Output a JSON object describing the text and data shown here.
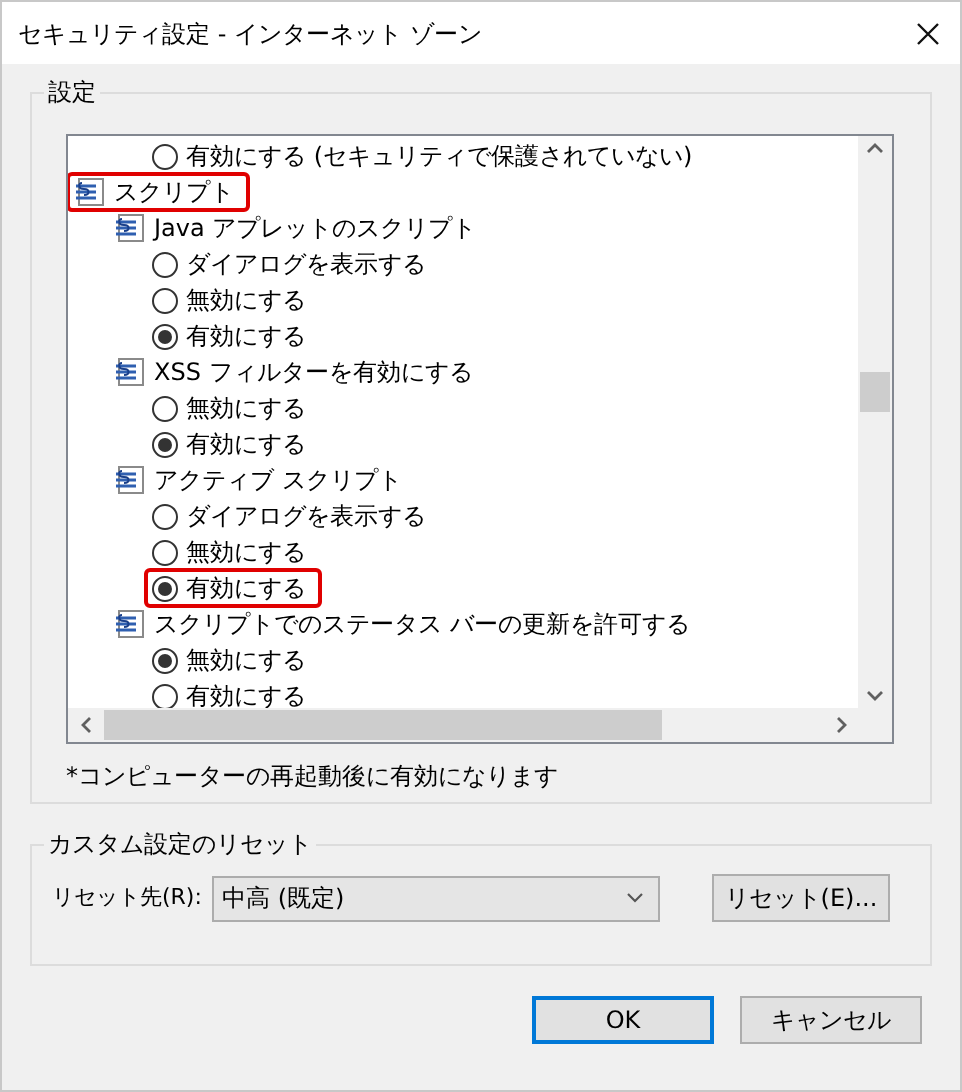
{
  "window": {
    "title": "セキュリティ設定 - インターネット ゾーン"
  },
  "settings_group": {
    "title": "設定",
    "list": [
      {
        "kind": "option",
        "label": "有効にする (セキュリティで保護されていない)",
        "selected": false,
        "highlighted": false
      },
      {
        "kind": "category",
        "label": "スクリプト",
        "highlighted": true,
        "children": [
          {
            "kind": "setting",
            "label": "Java アプレットのスクリプト",
            "highlighted": false,
            "children": [
              {
                "kind": "option",
                "label": "ダイアログを表示する",
                "selected": false,
                "highlighted": false
              },
              {
                "kind": "option",
                "label": "無効にする",
                "selected": false,
                "highlighted": false
              },
              {
                "kind": "option",
                "label": "有効にする",
                "selected": true,
                "highlighted": false
              }
            ]
          },
          {
            "kind": "setting",
            "label": "XSS フィルターを有効にする",
            "highlighted": false,
            "children": [
              {
                "kind": "option",
                "label": "無効にする",
                "selected": false,
                "highlighted": false
              },
              {
                "kind": "option",
                "label": "有効にする",
                "selected": true,
                "highlighted": false
              }
            ]
          },
          {
            "kind": "setting",
            "label": "アクティブ スクリプト",
            "highlighted": false,
            "children": [
              {
                "kind": "option",
                "label": "ダイアログを表示する",
                "selected": false,
                "highlighted": false
              },
              {
                "kind": "option",
                "label": "無効にする",
                "selected": false,
                "highlighted": false
              },
              {
                "kind": "option",
                "label": "有効にする",
                "selected": true,
                "highlighted": true
              }
            ]
          },
          {
            "kind": "setting",
            "label": "スクリプトでのステータス バーの更新を許可する",
            "highlighted": false,
            "children": [
              {
                "kind": "option",
                "label": "無効にする",
                "selected": true,
                "highlighted": false
              },
              {
                "kind": "option",
                "label": "有効にする",
                "selected": false,
                "highlighted": false
              }
            ]
          }
        ]
      }
    ],
    "note": "*コンピューターの再起動後に有効になります"
  },
  "reset_group": {
    "title": "カスタム設定のリセット",
    "label": "リセット先(R):",
    "dropdown_value": "中高 (既定)",
    "reset_button": "リセット(E)..."
  },
  "buttons": [
    {
      "label": "OK",
      "default": true
    },
    {
      "label": "キャンセル",
      "default": false
    }
  ]
}
